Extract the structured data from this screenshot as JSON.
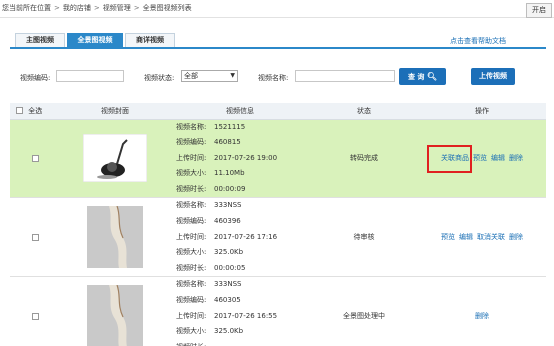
{
  "breadcrumb": {
    "prefix": "您当前所在位置",
    "items": [
      "我的店铺",
      "视频管理",
      "全景图视频列表"
    ]
  },
  "open_button": "开启",
  "tabs": [
    {
      "label": "主图视频",
      "active": false
    },
    {
      "label": "全景图视频",
      "active": true
    },
    {
      "label": "商详视频",
      "active": false
    }
  ],
  "help_link": "点击查看帮助文档",
  "search": {
    "code_label": "视频编码:",
    "status_label": "视频状态:",
    "status_value": "全部",
    "name_label": "视频名称:",
    "query_button": "查 询",
    "upload_button": "上传视频"
  },
  "table": {
    "headers": [
      "全选",
      "视频封面",
      "视频信息",
      "状态",
      "操作"
    ],
    "field_labels": {
      "name": "视频名称:",
      "code": "视频编码:",
      "time": "上传时间:",
      "size": "视频大小:",
      "duration": "视频时长:"
    },
    "rows": [
      {
        "name": "1521115",
        "code": "460815",
        "time": "2017-07-26 19:00",
        "size": "11.10Mb",
        "duration": "00:00:09",
        "status": "转码完成",
        "actions": [
          "关联商品",
          "预览",
          "编辑",
          "删除"
        ]
      },
      {
        "name": "333NSS",
        "code": "460396",
        "time": "2017-07-26 17:16",
        "size": "325.0Kb",
        "duration": "00:00:05",
        "status": "待审核",
        "actions": [
          "预览",
          "编辑",
          "取消关联",
          "删除"
        ]
      },
      {
        "name": "333NSS",
        "code": "460305",
        "time": "2017-07-26 16:55",
        "size": "325.0Kb",
        "duration": "",
        "status": "全景图处理中",
        "actions": [
          "删除"
        ]
      }
    ]
  },
  "colors": {
    "accent": "#2b88c9",
    "button": "#1c6fb8",
    "selected_row": "#d9f2bb",
    "highlight_box": "#e02020",
    "link": "#1a6fb5"
  }
}
